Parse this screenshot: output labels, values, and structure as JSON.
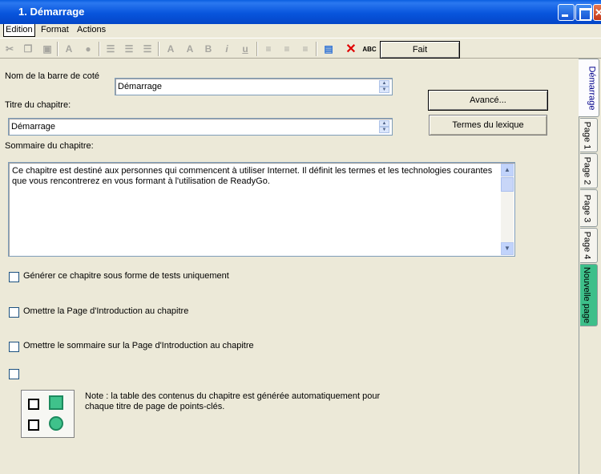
{
  "window": {
    "title": "1. Démarrage"
  },
  "menu": [
    "Edition",
    "Format",
    "Actions"
  ],
  "toolbar": {
    "fait_label": "Fait"
  },
  "form": {
    "nom_label": "Nom de la barre de coté",
    "nom_value": "Démarrage",
    "titre_label": "Titre du chapitre:",
    "titre_value": "Démarrage",
    "sommaire_label": "Sommaire du chapitre:",
    "sommaire_value": "Ce chapitre est destiné aux personnes qui commencent à utiliser Internet. Il définit les termes et les technologies courantes que vous rencontrerez en vous formant à l'utilisation de ReadyGo.",
    "avance_label": "Avancé...",
    "lexique_label": "Termes du lexique"
  },
  "options": [
    {
      "label": "Générer ce chapitre sous forme de tests uniquement",
      "checked": false
    },
    {
      "label": "Omettre la Page d'Introduction au chapitre",
      "checked": false
    },
    {
      "label": "Omettre le sommaire sur la Page d'Introduction au chapitre",
      "checked": false
    },
    {
      "label": "",
      "checked": false
    }
  ],
  "note": "Note : la table des contenus du chapitre est générée automatiquement pour chaque titre de page de points-clés.",
  "tabs": [
    "Démarrage",
    "Page 1",
    "Page 2",
    "Page 3",
    "Page 4",
    "Nouvelle page"
  ],
  "icons": [
    "cut-icon",
    "copy-icon",
    "paste-icon",
    "font-icon",
    "color-icon",
    "bullet-list-icon",
    "numbered-list-icon",
    "outline-list-icon",
    "superscript-icon",
    "subscript-icon",
    "bold-icon",
    "italic-icon",
    "underline-icon",
    "align-left-icon",
    "align-center-icon",
    "align-right-icon",
    "books-icon",
    "delete-icon",
    "spellcheck-icon"
  ],
  "colors": {
    "titlebar": "#0a5fe0",
    "background": "#ece9d8",
    "new_page_tab": "#3dbf8a",
    "delete_icon": "#e00000"
  }
}
